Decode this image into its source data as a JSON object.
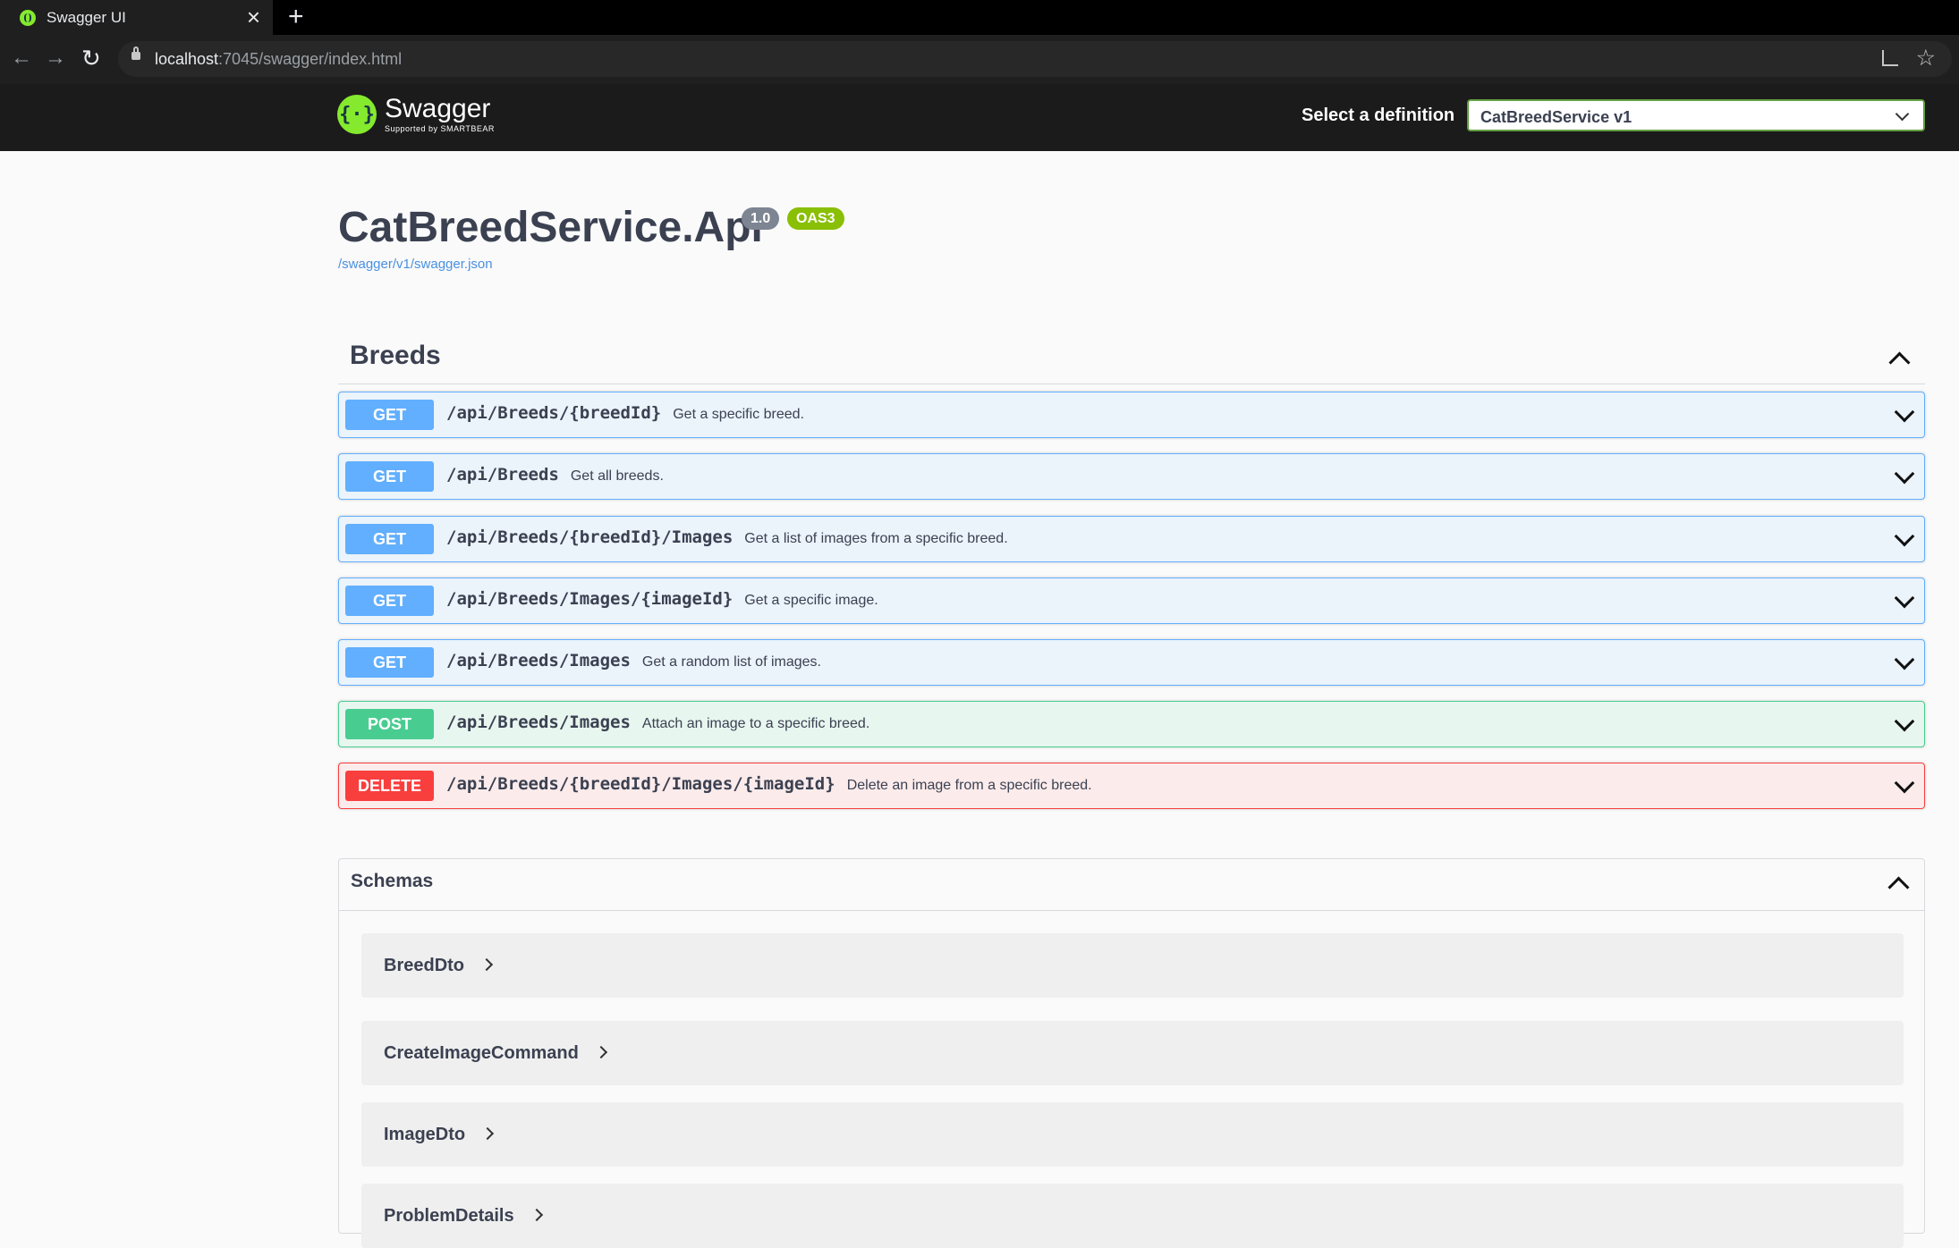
{
  "browser": {
    "tab_title": "Swagger UI",
    "url_host": "localhost",
    "url_rest": ":7045/swagger/index.html"
  },
  "topbar": {
    "logo_name": "Swagger",
    "logo_tagline": "Supported by SMARTBEAR",
    "definition_label": "Select a definition",
    "definition_value": "CatBreedService v1"
  },
  "info": {
    "title": "CatBreedService.Api",
    "version": "1.0",
    "oas": "OAS3",
    "spec_link": "/swagger/v1/swagger.json"
  },
  "tag": {
    "name": "Breeds",
    "operations": [
      {
        "method": "GET",
        "path": "/api/Breeds/{breedId}",
        "summary": "Get a specific breed."
      },
      {
        "method": "GET",
        "path": "/api/Breeds",
        "summary": "Get all breeds."
      },
      {
        "method": "GET",
        "path": "/api/Breeds/{breedId}/Images",
        "summary": "Get a list of images from a specific breed."
      },
      {
        "method": "GET",
        "path": "/api/Breeds/Images/{imageId}",
        "summary": "Get a specific image."
      },
      {
        "method": "GET",
        "path": "/api/Breeds/Images",
        "summary": "Get a random list of images."
      },
      {
        "method": "POST",
        "path": "/api/Breeds/Images",
        "summary": "Attach an image to a specific breed."
      },
      {
        "method": "DELETE",
        "path": "/api/Breeds/{breedId}/Images/{imageId}",
        "summary": "Delete an image from a specific breed."
      }
    ]
  },
  "schemas": {
    "title": "Schemas",
    "models": [
      "BreedDto",
      "CreateImageCommand",
      "ImageDto",
      "ProblemDetails"
    ]
  },
  "colors": {
    "get": "#61affe",
    "post": "#49cc90",
    "delete": "#f93e3e",
    "swagger_green": "#85ea2d"
  }
}
